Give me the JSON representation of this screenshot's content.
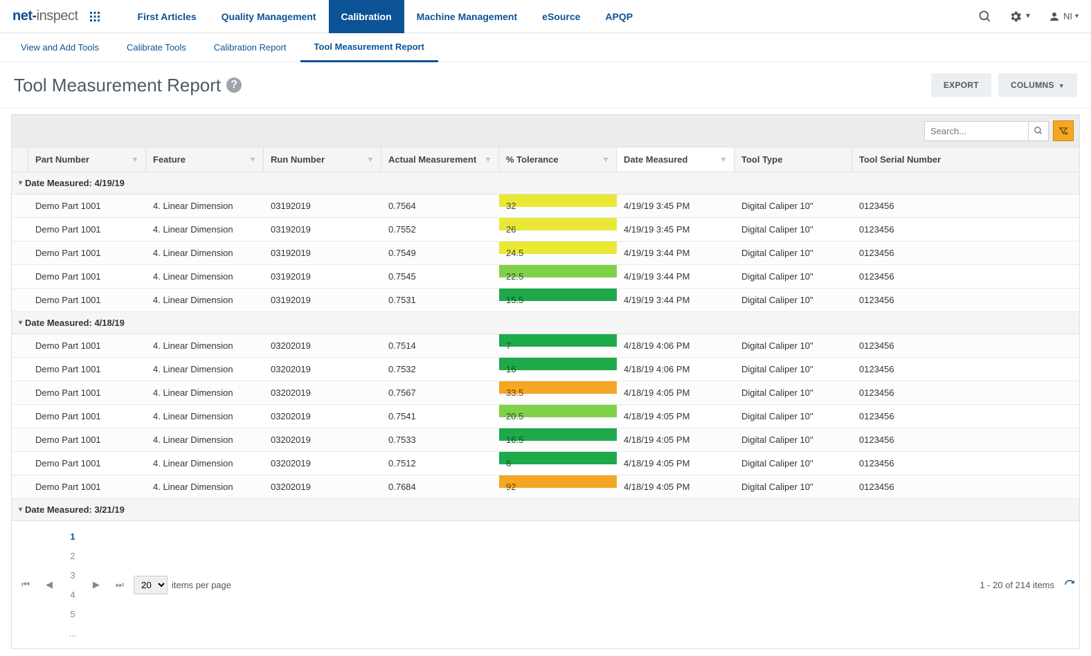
{
  "brand": {
    "part1": "net-",
    "part2": "inspect"
  },
  "topnav": {
    "items": [
      "First Articles",
      "Quality Management",
      "Calibration",
      "Machine Management",
      "eSource",
      "APQP"
    ],
    "active_index": 2,
    "user_label": "NI"
  },
  "subtabs": {
    "items": [
      "View and Add Tools",
      "Calibrate Tools",
      "Calibration Report",
      "Tool Measurement Report"
    ],
    "active_index": 3
  },
  "page": {
    "title": "Tool Measurement Report",
    "export_label": "EXPORT",
    "columns_label": "COLUMNS"
  },
  "toolbar": {
    "search_placeholder": "Search..."
  },
  "columns": [
    "Part Number",
    "Feature",
    "Run Number",
    "Actual Measurement",
    "% Tolerance",
    "Date Measured",
    "Tool Type",
    "Tool Serial Number"
  ],
  "sort_column_index": 5,
  "groups": [
    {
      "label": "Date Measured: 4/19/19",
      "rows": [
        {
          "part": "Demo Part 1001",
          "feature": "4. Linear Dimension",
          "run": "03192019",
          "actual": "0.7564",
          "tol": "32",
          "tol_class": "tol-yellow",
          "date": "4/19/19 3:45 PM",
          "type": "Digital Caliper 10\"",
          "serial": "0123456"
        },
        {
          "part": "Demo Part 1001",
          "feature": "4. Linear Dimension",
          "run": "03192019",
          "actual": "0.7552",
          "tol": "26",
          "tol_class": "tol-yellow",
          "date": "4/19/19 3:45 PM",
          "type": "Digital Caliper 10\"",
          "serial": "0123456"
        },
        {
          "part": "Demo Part 1001",
          "feature": "4. Linear Dimension",
          "run": "03192019",
          "actual": "0.7549",
          "tol": "24.5",
          "tol_class": "tol-yellow",
          "date": "4/19/19 3:44 PM",
          "type": "Digital Caliper 10\"",
          "serial": "0123456"
        },
        {
          "part": "Demo Part 1001",
          "feature": "4. Linear Dimension",
          "run": "03192019",
          "actual": "0.7545",
          "tol": "22.5",
          "tol_class": "tol-lime",
          "date": "4/19/19 3:44 PM",
          "type": "Digital Caliper 10\"",
          "serial": "0123456"
        },
        {
          "part": "Demo Part 1001",
          "feature": "4. Linear Dimension",
          "run": "03192019",
          "actual": "0.7531",
          "tol": "15.5",
          "tol_class": "tol-green",
          "date": "4/19/19 3:44 PM",
          "type": "Digital Caliper 10\"",
          "serial": "0123456"
        }
      ]
    },
    {
      "label": "Date Measured: 4/18/19",
      "rows": [
        {
          "part": "Demo Part 1001",
          "feature": "4. Linear Dimension",
          "run": "03202019",
          "actual": "0.7514",
          "tol": "7",
          "tol_class": "tol-green",
          "date": "4/18/19 4:06 PM",
          "type": "Digital Caliper 10\"",
          "serial": "0123456"
        },
        {
          "part": "Demo Part 1001",
          "feature": "4. Linear Dimension",
          "run": "03202019",
          "actual": "0.7532",
          "tol": "16",
          "tol_class": "tol-green",
          "date": "4/18/19 4:06 PM",
          "type": "Digital Caliper 10\"",
          "serial": "0123456"
        },
        {
          "part": "Demo Part 1001",
          "feature": "4. Linear Dimension",
          "run": "03202019",
          "actual": "0.7567",
          "tol": "33.5",
          "tol_class": "tol-orange",
          "date": "4/18/19 4:05 PM",
          "type": "Digital Caliper 10\"",
          "serial": "0123456"
        },
        {
          "part": "Demo Part 1001",
          "feature": "4. Linear Dimension",
          "run": "03202019",
          "actual": "0.7541",
          "tol": "20.5",
          "tol_class": "tol-lime",
          "date": "4/18/19 4:05 PM",
          "type": "Digital Caliper 10\"",
          "serial": "0123456"
        },
        {
          "part": "Demo Part 1001",
          "feature": "4. Linear Dimension",
          "run": "03202019",
          "actual": "0.7533",
          "tol": "16.5",
          "tol_class": "tol-green",
          "date": "4/18/19 4:05 PM",
          "type": "Digital Caliper 10\"",
          "serial": "0123456"
        },
        {
          "part": "Demo Part 1001",
          "feature": "4. Linear Dimension",
          "run": "03202019",
          "actual": "0.7512",
          "tol": "6",
          "tol_class": "tol-green",
          "date": "4/18/19 4:05 PM",
          "type": "Digital Caliper 10\"",
          "serial": "0123456"
        },
        {
          "part": "Demo Part 1001",
          "feature": "4. Linear Dimension",
          "run": "03202019",
          "actual": "0.7684",
          "tol": "92",
          "tol_class": "tol-orange",
          "date": "4/18/19 4:05 PM",
          "type": "Digital Caliper 10\"",
          "serial": "0123456"
        }
      ]
    },
    {
      "label": "Date Measured: 3/21/19",
      "rows": []
    }
  ],
  "pager": {
    "pages": [
      "1",
      "2",
      "3",
      "4",
      "5",
      "..."
    ],
    "active_page_index": 0,
    "page_size": "20",
    "page_size_label": "items per page",
    "info": "1 - 20 of 214 items"
  }
}
